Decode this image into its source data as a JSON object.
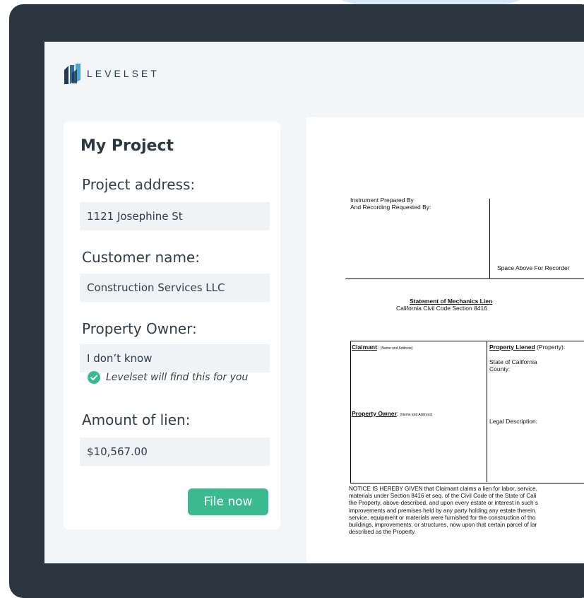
{
  "brand": {
    "name": "LEVELSET",
    "primary_color": "#1f3a52",
    "accent_color": "#3bb98f"
  },
  "card": {
    "title": "My Project",
    "fields": [
      {
        "label": "Project address:",
        "value": "1121 Josephine St"
      },
      {
        "label": "Customer name:",
        "value": "Construction Services LLC"
      },
      {
        "label": "Property Owner:",
        "value": "I don’t know"
      },
      {
        "label": "Amount of lien:",
        "value": "$10,567.00"
      }
    ],
    "hint": "Levelset will find this for you",
    "hint_icon": "check-circle-icon",
    "file_button": "File now"
  },
  "document": {
    "prepared_by_1": "Instrument Prepared By",
    "prepared_by_2": "And Recording Requested By:",
    "space_above": "Space Above For Recorder",
    "title": "Statement of Mechanics Lien",
    "subtitle": "California Civil Code Section 8416",
    "claimant_label": "Claimant",
    "claimant_suffix": ":",
    "claimant_note": "(Name and Address)",
    "owner_label": "Property Owner",
    "owner_suffix": ":",
    "owner_note": "(Name and Address)",
    "liened_label": "Property Liened",
    "liened_suffix": " (Property):",
    "state": "State of California",
    "county": "County:",
    "legal": "Legal Description:",
    "notice": [
      "NOTICE IS HEREBY GIVEN that Claimant claims a lien for labor, service,",
      "materials under Section 8416 et seq. of the Civil Code of the State of Cali",
      "the Property, above-described, and upon every estate or interest in such s",
      "improvements and premises held by any party holding any estate therein.",
      "service, equipment or materials were furnished for the construction of tho",
      "buildings, improvements, or structures, now upon that certain parcel of lar",
      "described as the Property."
    ]
  }
}
